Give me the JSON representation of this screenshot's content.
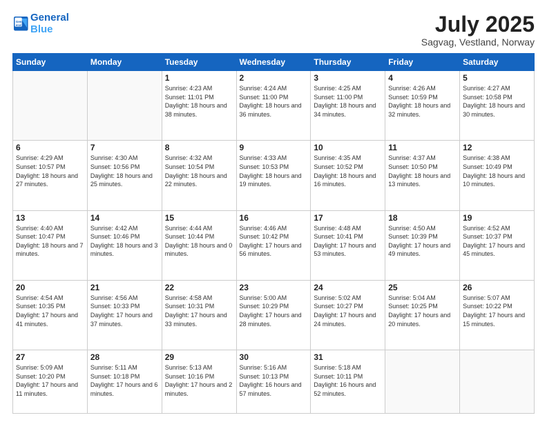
{
  "header": {
    "logo_line1": "General",
    "logo_line2": "Blue",
    "month": "July 2025",
    "location": "Sagvag, Vestland, Norway"
  },
  "weekdays": [
    "Sunday",
    "Monday",
    "Tuesday",
    "Wednesday",
    "Thursday",
    "Friday",
    "Saturday"
  ],
  "weeks": [
    [
      {
        "day": "",
        "info": ""
      },
      {
        "day": "",
        "info": ""
      },
      {
        "day": "1",
        "info": "Sunrise: 4:23 AM\nSunset: 11:01 PM\nDaylight: 18 hours and 38 minutes."
      },
      {
        "day": "2",
        "info": "Sunrise: 4:24 AM\nSunset: 11:00 PM\nDaylight: 18 hours and 36 minutes."
      },
      {
        "day": "3",
        "info": "Sunrise: 4:25 AM\nSunset: 11:00 PM\nDaylight: 18 hours and 34 minutes."
      },
      {
        "day": "4",
        "info": "Sunrise: 4:26 AM\nSunset: 10:59 PM\nDaylight: 18 hours and 32 minutes."
      },
      {
        "day": "5",
        "info": "Sunrise: 4:27 AM\nSunset: 10:58 PM\nDaylight: 18 hours and 30 minutes."
      }
    ],
    [
      {
        "day": "6",
        "info": "Sunrise: 4:29 AM\nSunset: 10:57 PM\nDaylight: 18 hours and 27 minutes."
      },
      {
        "day": "7",
        "info": "Sunrise: 4:30 AM\nSunset: 10:56 PM\nDaylight: 18 hours and 25 minutes."
      },
      {
        "day": "8",
        "info": "Sunrise: 4:32 AM\nSunset: 10:54 PM\nDaylight: 18 hours and 22 minutes."
      },
      {
        "day": "9",
        "info": "Sunrise: 4:33 AM\nSunset: 10:53 PM\nDaylight: 18 hours and 19 minutes."
      },
      {
        "day": "10",
        "info": "Sunrise: 4:35 AM\nSunset: 10:52 PM\nDaylight: 18 hours and 16 minutes."
      },
      {
        "day": "11",
        "info": "Sunrise: 4:37 AM\nSunset: 10:50 PM\nDaylight: 18 hours and 13 minutes."
      },
      {
        "day": "12",
        "info": "Sunrise: 4:38 AM\nSunset: 10:49 PM\nDaylight: 18 hours and 10 minutes."
      }
    ],
    [
      {
        "day": "13",
        "info": "Sunrise: 4:40 AM\nSunset: 10:47 PM\nDaylight: 18 hours and 7 minutes."
      },
      {
        "day": "14",
        "info": "Sunrise: 4:42 AM\nSunset: 10:46 PM\nDaylight: 18 hours and 3 minutes."
      },
      {
        "day": "15",
        "info": "Sunrise: 4:44 AM\nSunset: 10:44 PM\nDaylight: 18 hours and 0 minutes."
      },
      {
        "day": "16",
        "info": "Sunrise: 4:46 AM\nSunset: 10:42 PM\nDaylight: 17 hours and 56 minutes."
      },
      {
        "day": "17",
        "info": "Sunrise: 4:48 AM\nSunset: 10:41 PM\nDaylight: 17 hours and 53 minutes."
      },
      {
        "day": "18",
        "info": "Sunrise: 4:50 AM\nSunset: 10:39 PM\nDaylight: 17 hours and 49 minutes."
      },
      {
        "day": "19",
        "info": "Sunrise: 4:52 AM\nSunset: 10:37 PM\nDaylight: 17 hours and 45 minutes."
      }
    ],
    [
      {
        "day": "20",
        "info": "Sunrise: 4:54 AM\nSunset: 10:35 PM\nDaylight: 17 hours and 41 minutes."
      },
      {
        "day": "21",
        "info": "Sunrise: 4:56 AM\nSunset: 10:33 PM\nDaylight: 17 hours and 37 minutes."
      },
      {
        "day": "22",
        "info": "Sunrise: 4:58 AM\nSunset: 10:31 PM\nDaylight: 17 hours and 33 minutes."
      },
      {
        "day": "23",
        "info": "Sunrise: 5:00 AM\nSunset: 10:29 PM\nDaylight: 17 hours and 28 minutes."
      },
      {
        "day": "24",
        "info": "Sunrise: 5:02 AM\nSunset: 10:27 PM\nDaylight: 17 hours and 24 minutes."
      },
      {
        "day": "25",
        "info": "Sunrise: 5:04 AM\nSunset: 10:25 PM\nDaylight: 17 hours and 20 minutes."
      },
      {
        "day": "26",
        "info": "Sunrise: 5:07 AM\nSunset: 10:22 PM\nDaylight: 17 hours and 15 minutes."
      }
    ],
    [
      {
        "day": "27",
        "info": "Sunrise: 5:09 AM\nSunset: 10:20 PM\nDaylight: 17 hours and 11 minutes."
      },
      {
        "day": "28",
        "info": "Sunrise: 5:11 AM\nSunset: 10:18 PM\nDaylight: 17 hours and 6 minutes."
      },
      {
        "day": "29",
        "info": "Sunrise: 5:13 AM\nSunset: 10:16 PM\nDaylight: 17 hours and 2 minutes."
      },
      {
        "day": "30",
        "info": "Sunrise: 5:16 AM\nSunset: 10:13 PM\nDaylight: 16 hours and 57 minutes."
      },
      {
        "day": "31",
        "info": "Sunrise: 5:18 AM\nSunset: 10:11 PM\nDaylight: 16 hours and 52 minutes."
      },
      {
        "day": "",
        "info": ""
      },
      {
        "day": "",
        "info": ""
      }
    ]
  ]
}
